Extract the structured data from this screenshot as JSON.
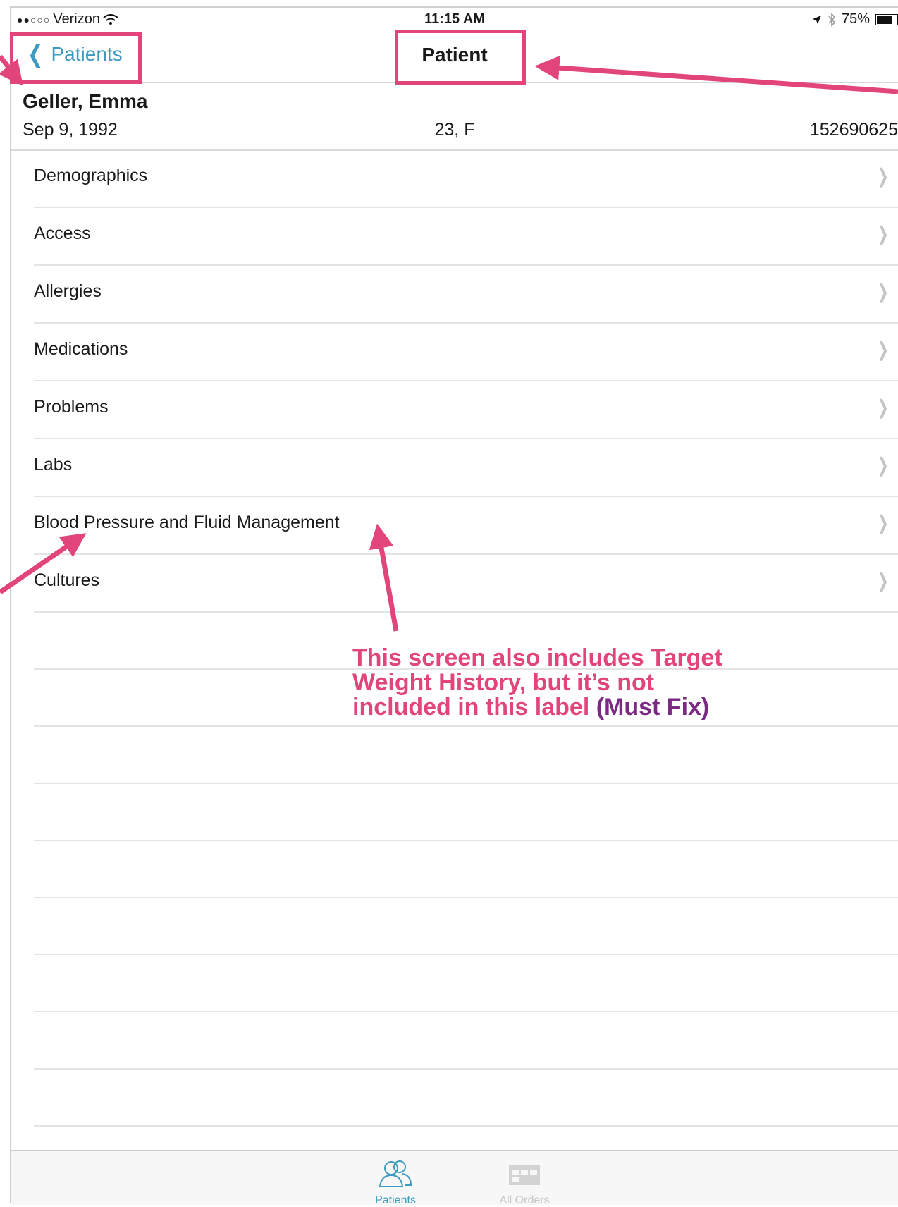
{
  "status_bar": {
    "carrier": "Verizon",
    "signal": "●●○○○",
    "time": "11:15 AM",
    "battery": "75%"
  },
  "nav": {
    "back_label": "Patients",
    "title": "Patient"
  },
  "patient": {
    "name": "Geller, Emma",
    "dob": "Sep 9, 1992",
    "age_sex": "23, F",
    "mrn": "152690625"
  },
  "menu": {
    "items": [
      {
        "label": "Demographics"
      },
      {
        "label": "Access"
      },
      {
        "label": "Allergies"
      },
      {
        "label": "Medications"
      },
      {
        "label": "Problems"
      },
      {
        "label": "Labs"
      },
      {
        "label": "Blood Pressure and Fluid Management"
      },
      {
        "label": "Cultures"
      }
    ]
  },
  "tabs": {
    "patients_label": "Patients",
    "orders_label": "All Orders"
  },
  "annotation": {
    "text": "This screen also includes Target Weight History, but it’s not included in this label",
    "must_fix": "(Must Fix)",
    "color": "#e2457c",
    "must_fix_color": "#7a2a83"
  }
}
